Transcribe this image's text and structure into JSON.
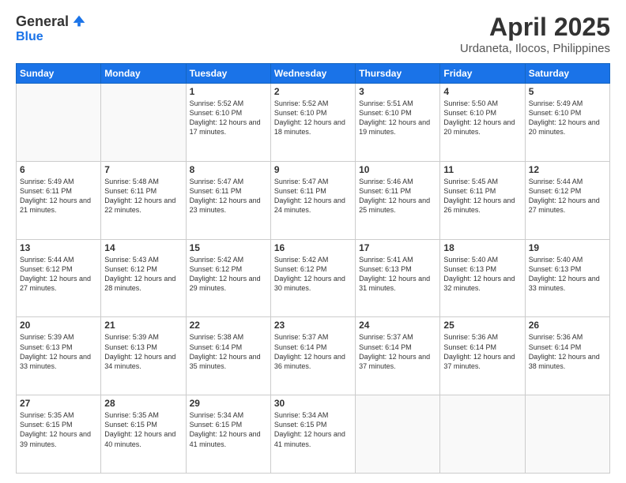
{
  "logo": {
    "general": "General",
    "blue": "Blue"
  },
  "title": "April 2025",
  "subtitle": "Urdaneta, Ilocos, Philippines",
  "days_of_week": [
    "Sunday",
    "Monday",
    "Tuesday",
    "Wednesday",
    "Thursday",
    "Friday",
    "Saturday"
  ],
  "weeks": [
    [
      {
        "day": "",
        "info": ""
      },
      {
        "day": "",
        "info": ""
      },
      {
        "day": "1",
        "info": "Sunrise: 5:52 AM\nSunset: 6:10 PM\nDaylight: 12 hours and 17 minutes."
      },
      {
        "day": "2",
        "info": "Sunrise: 5:52 AM\nSunset: 6:10 PM\nDaylight: 12 hours and 18 minutes."
      },
      {
        "day": "3",
        "info": "Sunrise: 5:51 AM\nSunset: 6:10 PM\nDaylight: 12 hours and 19 minutes."
      },
      {
        "day": "4",
        "info": "Sunrise: 5:50 AM\nSunset: 6:10 PM\nDaylight: 12 hours and 20 minutes."
      },
      {
        "day": "5",
        "info": "Sunrise: 5:49 AM\nSunset: 6:10 PM\nDaylight: 12 hours and 20 minutes."
      }
    ],
    [
      {
        "day": "6",
        "info": "Sunrise: 5:49 AM\nSunset: 6:11 PM\nDaylight: 12 hours and 21 minutes."
      },
      {
        "day": "7",
        "info": "Sunrise: 5:48 AM\nSunset: 6:11 PM\nDaylight: 12 hours and 22 minutes."
      },
      {
        "day": "8",
        "info": "Sunrise: 5:47 AM\nSunset: 6:11 PM\nDaylight: 12 hours and 23 minutes."
      },
      {
        "day": "9",
        "info": "Sunrise: 5:47 AM\nSunset: 6:11 PM\nDaylight: 12 hours and 24 minutes."
      },
      {
        "day": "10",
        "info": "Sunrise: 5:46 AM\nSunset: 6:11 PM\nDaylight: 12 hours and 25 minutes."
      },
      {
        "day": "11",
        "info": "Sunrise: 5:45 AM\nSunset: 6:11 PM\nDaylight: 12 hours and 26 minutes."
      },
      {
        "day": "12",
        "info": "Sunrise: 5:44 AM\nSunset: 6:12 PM\nDaylight: 12 hours and 27 minutes."
      }
    ],
    [
      {
        "day": "13",
        "info": "Sunrise: 5:44 AM\nSunset: 6:12 PM\nDaylight: 12 hours and 27 minutes."
      },
      {
        "day": "14",
        "info": "Sunrise: 5:43 AM\nSunset: 6:12 PM\nDaylight: 12 hours and 28 minutes."
      },
      {
        "day": "15",
        "info": "Sunrise: 5:42 AM\nSunset: 6:12 PM\nDaylight: 12 hours and 29 minutes."
      },
      {
        "day": "16",
        "info": "Sunrise: 5:42 AM\nSunset: 6:12 PM\nDaylight: 12 hours and 30 minutes."
      },
      {
        "day": "17",
        "info": "Sunrise: 5:41 AM\nSunset: 6:13 PM\nDaylight: 12 hours and 31 minutes."
      },
      {
        "day": "18",
        "info": "Sunrise: 5:40 AM\nSunset: 6:13 PM\nDaylight: 12 hours and 32 minutes."
      },
      {
        "day": "19",
        "info": "Sunrise: 5:40 AM\nSunset: 6:13 PM\nDaylight: 12 hours and 33 minutes."
      }
    ],
    [
      {
        "day": "20",
        "info": "Sunrise: 5:39 AM\nSunset: 6:13 PM\nDaylight: 12 hours and 33 minutes."
      },
      {
        "day": "21",
        "info": "Sunrise: 5:39 AM\nSunset: 6:13 PM\nDaylight: 12 hours and 34 minutes."
      },
      {
        "day": "22",
        "info": "Sunrise: 5:38 AM\nSunset: 6:14 PM\nDaylight: 12 hours and 35 minutes."
      },
      {
        "day": "23",
        "info": "Sunrise: 5:37 AM\nSunset: 6:14 PM\nDaylight: 12 hours and 36 minutes."
      },
      {
        "day": "24",
        "info": "Sunrise: 5:37 AM\nSunset: 6:14 PM\nDaylight: 12 hours and 37 minutes."
      },
      {
        "day": "25",
        "info": "Sunrise: 5:36 AM\nSunset: 6:14 PM\nDaylight: 12 hours and 37 minutes."
      },
      {
        "day": "26",
        "info": "Sunrise: 5:36 AM\nSunset: 6:14 PM\nDaylight: 12 hours and 38 minutes."
      }
    ],
    [
      {
        "day": "27",
        "info": "Sunrise: 5:35 AM\nSunset: 6:15 PM\nDaylight: 12 hours and 39 minutes."
      },
      {
        "day": "28",
        "info": "Sunrise: 5:35 AM\nSunset: 6:15 PM\nDaylight: 12 hours and 40 minutes."
      },
      {
        "day": "29",
        "info": "Sunrise: 5:34 AM\nSunset: 6:15 PM\nDaylight: 12 hours and 41 minutes."
      },
      {
        "day": "30",
        "info": "Sunrise: 5:34 AM\nSunset: 6:15 PM\nDaylight: 12 hours and 41 minutes."
      },
      {
        "day": "",
        "info": ""
      },
      {
        "day": "",
        "info": ""
      },
      {
        "day": "",
        "info": ""
      }
    ]
  ]
}
